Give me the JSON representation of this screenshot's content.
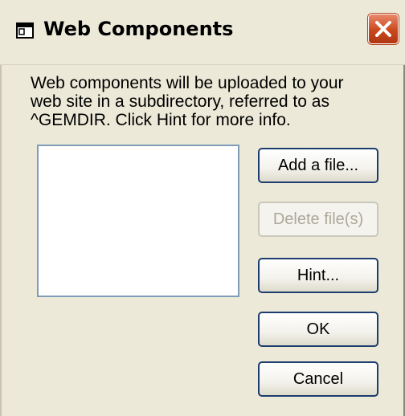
{
  "window": {
    "title": "Web Components",
    "icon": "app-window-icon",
    "close_icon": "close-icon"
  },
  "description": "Web components will be uploaded to your\nweb site in a subdirectory, referred to as\n^GEMDIR.  Click Hint for more info.",
  "file_list": {
    "items": []
  },
  "buttons": {
    "add": "Add a file...",
    "delete": "Delete file(s)",
    "hint": "Hint...",
    "ok": "OK",
    "cancel": "Cancel"
  },
  "colors": {
    "dialog_bg": "#ece9d8",
    "close_button": "#c9481d",
    "button_border": "#1c3d6e",
    "list_border": "#7f9db9"
  }
}
